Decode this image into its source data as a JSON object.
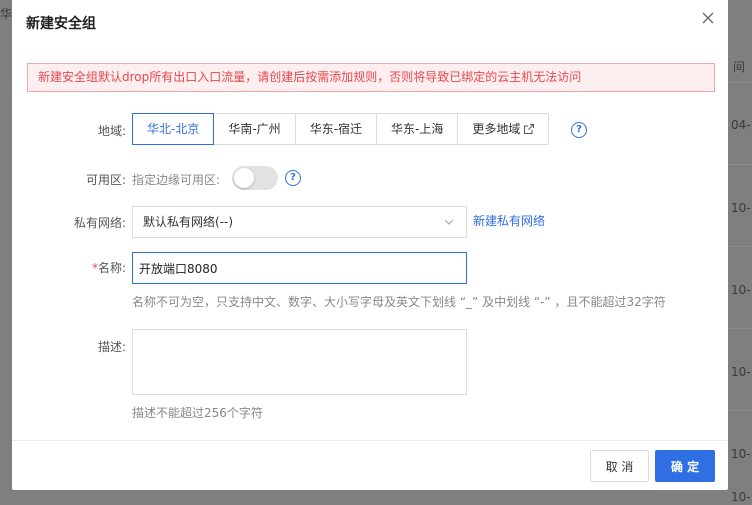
{
  "background": {
    "top_left_text": "华",
    "col_header": "间",
    "rows": [
      "04-",
      "10-",
      "10-",
      "10-",
      "10-",
      "10-"
    ]
  },
  "modal": {
    "title": "新建安全组",
    "warning": "新建安全组默认drop所有出口入口流量，请创建后按需添加规则，否则将导致已绑定的云主机无法访问",
    "region": {
      "label": "地域:",
      "options": [
        "华北-北京",
        "华南-广州",
        "华东-宿迁",
        "华东-上海",
        "更多地域"
      ],
      "selected_index": 0
    },
    "az": {
      "label": "可用区:",
      "hint": "指定边缘可用区:",
      "toggle_on": false
    },
    "vpc": {
      "label": "私有网络:",
      "value": "默认私有网络(--)",
      "new_link": "新建私有网络"
    },
    "name": {
      "required_mark": "*",
      "label": "名称:",
      "value": "开放端口8080",
      "hint": "名称不可为空，只支持中文、数字、大小写字母及英文下划线 “_” 及中划线 “-” ，且不能超过32字符"
    },
    "description": {
      "label": "描述:",
      "value": "",
      "hint": "描述不能超过256个字符"
    },
    "buttons": {
      "cancel": "取 消",
      "ok": "确 定"
    }
  },
  "colors": {
    "primary": "#2f6fe3",
    "warning_text": "#e8484f",
    "warning_bg": "#fdeff0",
    "warning_border": "#f1a7ac"
  }
}
